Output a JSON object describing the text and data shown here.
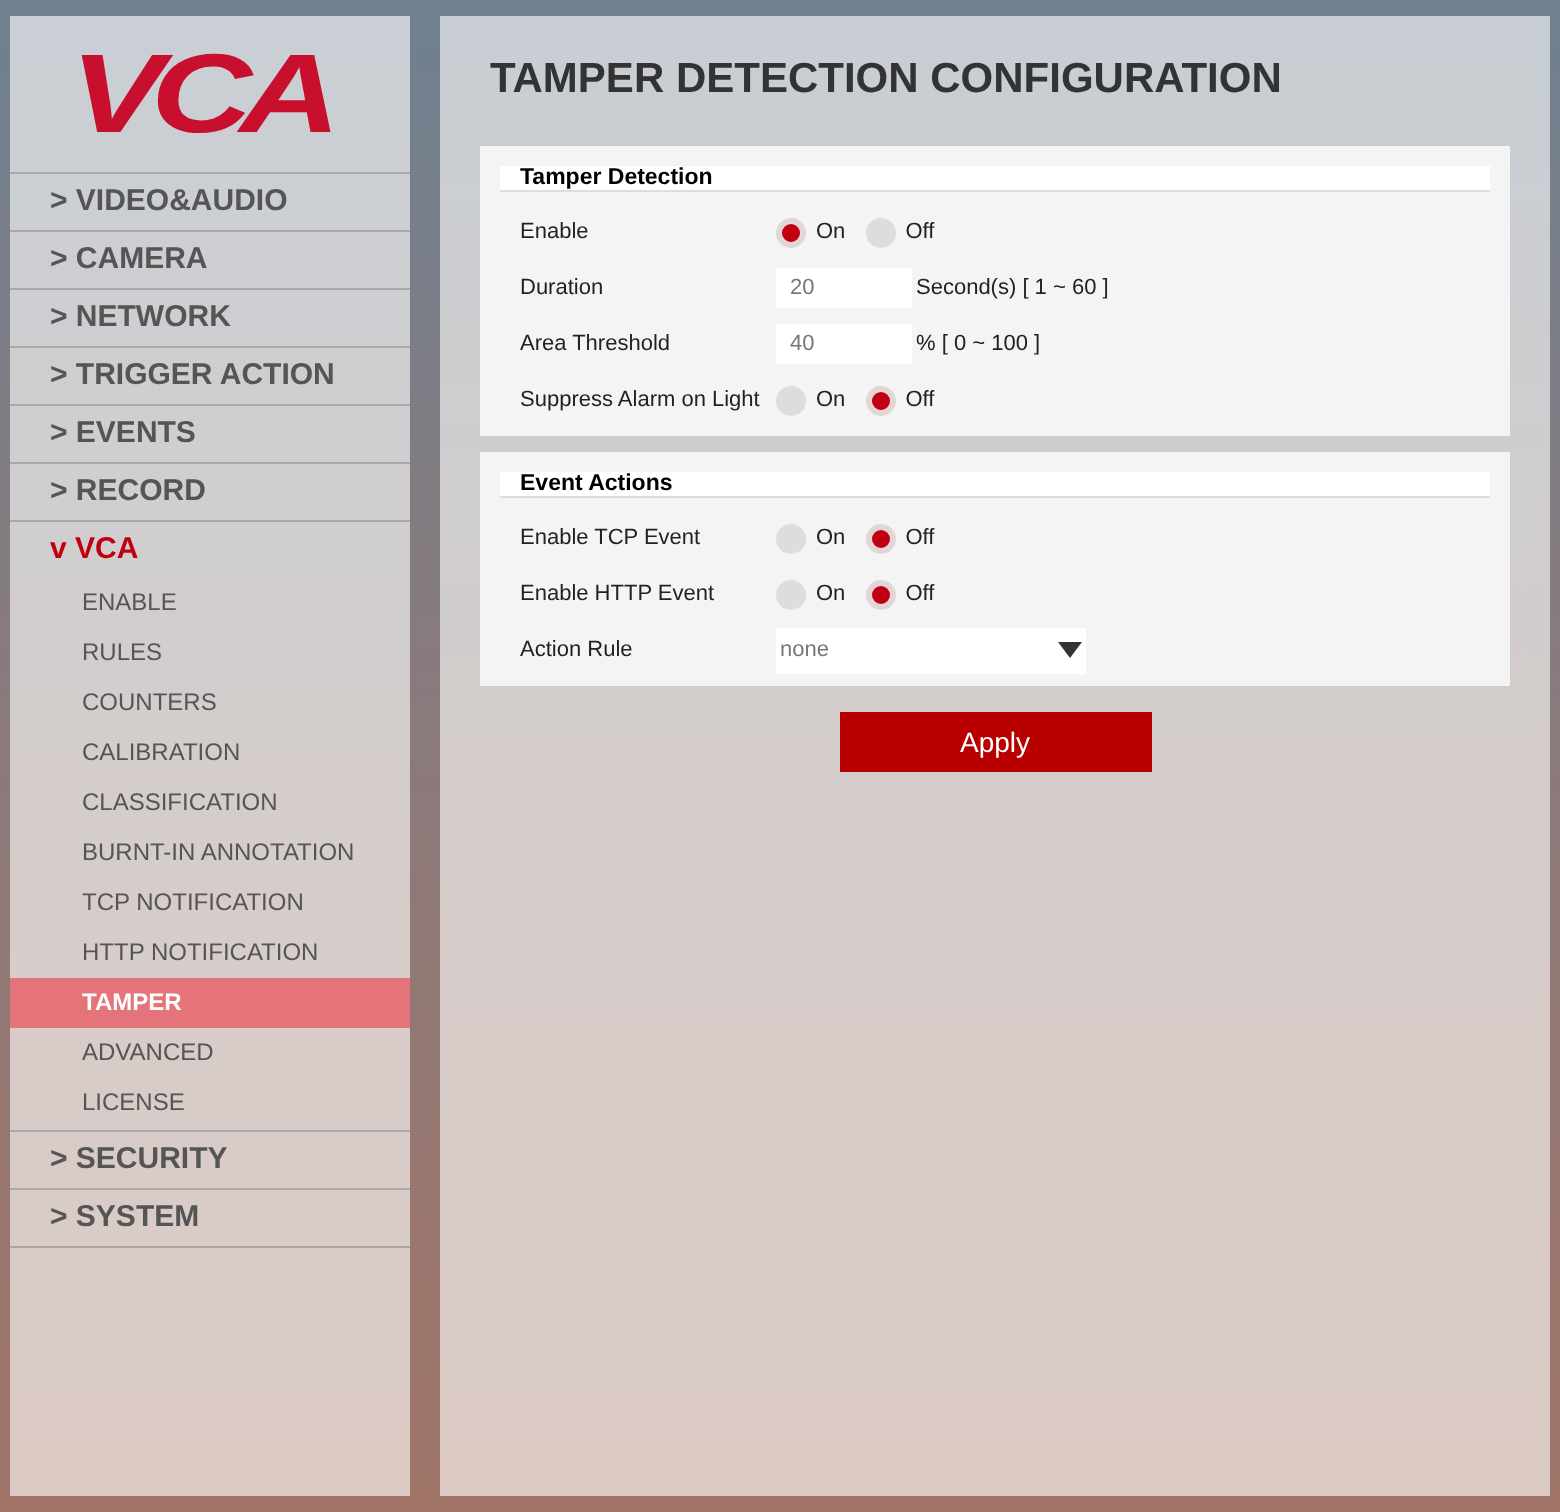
{
  "logo": "VCA",
  "sidebar": {
    "items": [
      {
        "label": "> VIDEO&AUDIO",
        "expanded": false
      },
      {
        "label": "> CAMERA",
        "expanded": false
      },
      {
        "label": "> NETWORK",
        "expanded": false
      },
      {
        "label": "> TRIGGER ACTION",
        "expanded": false
      },
      {
        "label": "> EVENTS",
        "expanded": false
      },
      {
        "label": "> RECORD",
        "expanded": false
      },
      {
        "label": "v VCA",
        "expanded": true,
        "children": [
          {
            "label": "ENABLE",
            "selected": false
          },
          {
            "label": "RULES",
            "selected": false
          },
          {
            "label": "COUNTERS",
            "selected": false
          },
          {
            "label": "CALIBRATION",
            "selected": false
          },
          {
            "label": "CLASSIFICATION",
            "selected": false
          },
          {
            "label": "BURNT-IN ANNOTATION",
            "selected": false
          },
          {
            "label": "TCP NOTIFICATION",
            "selected": false
          },
          {
            "label": "HTTP NOTIFICATION",
            "selected": false
          },
          {
            "label": "TAMPER",
            "selected": true
          },
          {
            "label": "ADVANCED",
            "selected": false
          },
          {
            "label": "LICENSE",
            "selected": false
          }
        ]
      },
      {
        "label": "> SECURITY",
        "expanded": false
      },
      {
        "label": "> SYSTEM",
        "expanded": false
      }
    ]
  },
  "page_title": "TAMPER DETECTION CONFIGURATION",
  "sections": [
    {
      "title": "Tamper Detection",
      "rows": [
        {
          "kind": "radio",
          "label": "Enable",
          "options": [
            {
              "label": "On",
              "selected": true
            },
            {
              "label": "Off",
              "selected": false
            }
          ]
        },
        {
          "kind": "input",
          "label": "Duration",
          "value": "20",
          "unit": "Second(s) [ 1 ~ 60 ]"
        },
        {
          "kind": "input",
          "label": "Area Threshold",
          "value": "40",
          "unit": "% [ 0 ~ 100 ]"
        },
        {
          "kind": "radio",
          "label": "Suppress Alarm on Light",
          "options": [
            {
              "label": "On",
              "selected": false
            },
            {
              "label": "Off",
              "selected": true
            }
          ]
        }
      ]
    },
    {
      "title": "Event Actions",
      "rows": [
        {
          "kind": "radio",
          "label": "Enable TCP Event",
          "options": [
            {
              "label": "On",
              "selected": false
            },
            {
              "label": "Off",
              "selected": true
            }
          ]
        },
        {
          "kind": "radio",
          "label": "Enable HTTP Event",
          "options": [
            {
              "label": "On",
              "selected": false
            },
            {
              "label": "Off",
              "selected": true
            }
          ]
        },
        {
          "kind": "select",
          "label": "Action Rule",
          "value": "none"
        }
      ]
    }
  ],
  "apply_button": "Apply"
}
